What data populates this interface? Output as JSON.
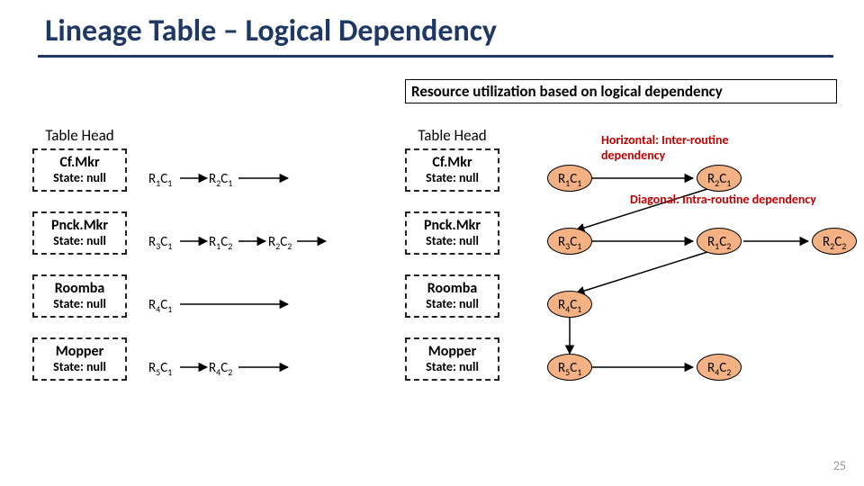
{
  "title": "Lineage Table – Logical Dependency",
  "subtitle": "Resource utilization based on logical dependency",
  "table_head": "Table Head",
  "state_label": "State: null",
  "routines": {
    "cf": {
      "name": "Cf.Mkr"
    },
    "pnck": {
      "name": "Pnck.Mkr"
    },
    "roomba": {
      "name": "Roomba"
    },
    "mopper": {
      "name": "Mopper"
    }
  },
  "nodes": {
    "r1c1": {
      "r": "1",
      "c": "1"
    },
    "r2c1": {
      "r": "2",
      "c": "1"
    },
    "r3c1": {
      "r": "3",
      "c": "1"
    },
    "r1c2": {
      "r": "1",
      "c": "2"
    },
    "r2c2": {
      "r": "2",
      "c": "2"
    },
    "r4c1": {
      "r": "4",
      "c": "1"
    },
    "r5c1": {
      "r": "5",
      "c": "1"
    },
    "r4c2": {
      "r": "4",
      "c": "2"
    }
  },
  "annotations": {
    "horizontal": "Horizontal: Inter-routine dependency",
    "diagonal": "Diagonal: Intra-routine dependency"
  },
  "colors": {
    "title": "#1F3864",
    "anno": "#BF0000",
    "oval_fill": "#F4B183"
  },
  "page_number": "25"
}
